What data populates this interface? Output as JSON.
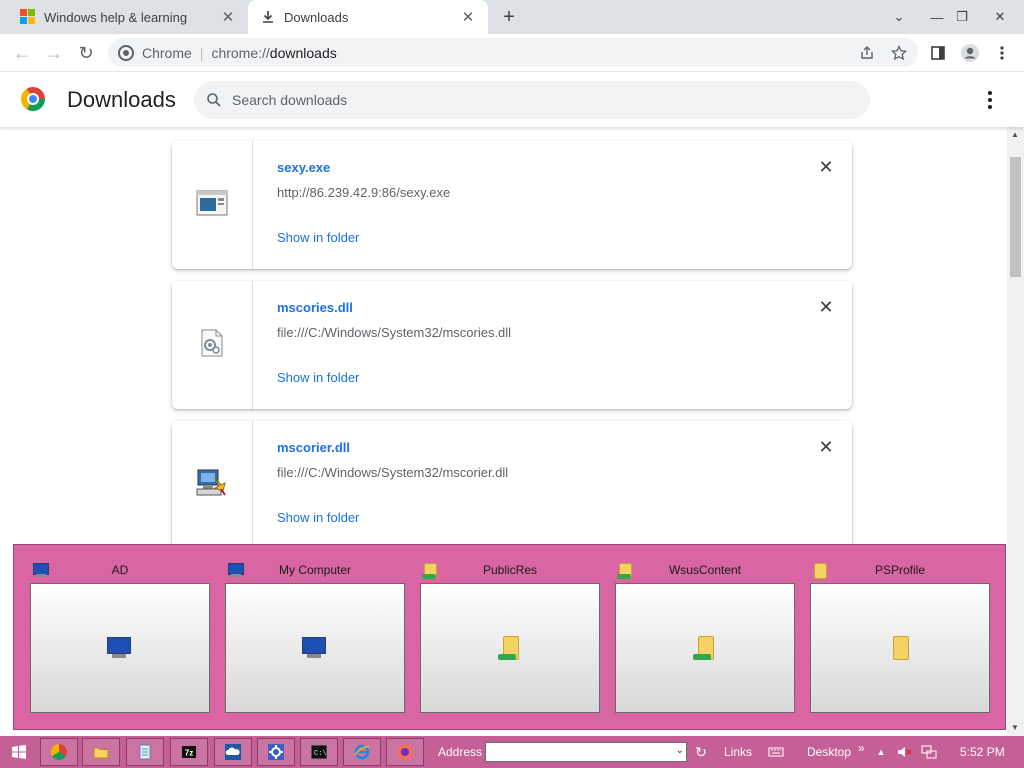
{
  "tabs": [
    {
      "title": "Windows help & learning",
      "close": "✕",
      "active": false
    },
    {
      "title": "Downloads",
      "close": "✕",
      "active": true
    }
  ],
  "toolbar": {
    "back": "←",
    "forward": "→",
    "reload": "↻",
    "url_chip": "Chrome",
    "url_separator": "|",
    "url_scheme": "chrome://",
    "url_path": "downloads"
  },
  "window_controls": {
    "dropdown": "⌄",
    "minimize": "—",
    "restore": "❐",
    "close": "✕"
  },
  "page": {
    "title": "Downloads",
    "search_placeholder": "Search downloads"
  },
  "downloads": [
    {
      "name": "sexy.exe",
      "url": "http://86.239.42.9:86/sexy.exe",
      "action": "Show in folder",
      "icon": "executable-icon"
    },
    {
      "name": "mscories.dll",
      "url": "file:///C:/Windows/System32/mscories.dll",
      "action": "Show in folder",
      "icon": "dll-file-icon"
    },
    {
      "name": "mscorier.dll",
      "url": "file:///C:/Windows/System32/mscorier.dll",
      "action": "Show in folder",
      "icon": "setup-computer-icon"
    }
  ],
  "overlay_tiles": [
    {
      "label": "AD",
      "icon": "computer-icon"
    },
    {
      "label": "My Computer",
      "icon": "computer-icon"
    },
    {
      "label": "PublicRes",
      "icon": "network-folder-icon"
    },
    {
      "label": "WsusContent",
      "icon": "network-folder-icon"
    },
    {
      "label": "PSProfile",
      "icon": "folder-icon"
    }
  ],
  "taskbar": {
    "address_label": "Address",
    "links_label": "Links",
    "desktop_label": "Desktop",
    "chevron": "»",
    "time": "5:52 PM"
  },
  "colors": {
    "overlay_bg": "#d966a3",
    "taskbar_bg": "#c46096",
    "link_blue": "#1a73e8"
  }
}
